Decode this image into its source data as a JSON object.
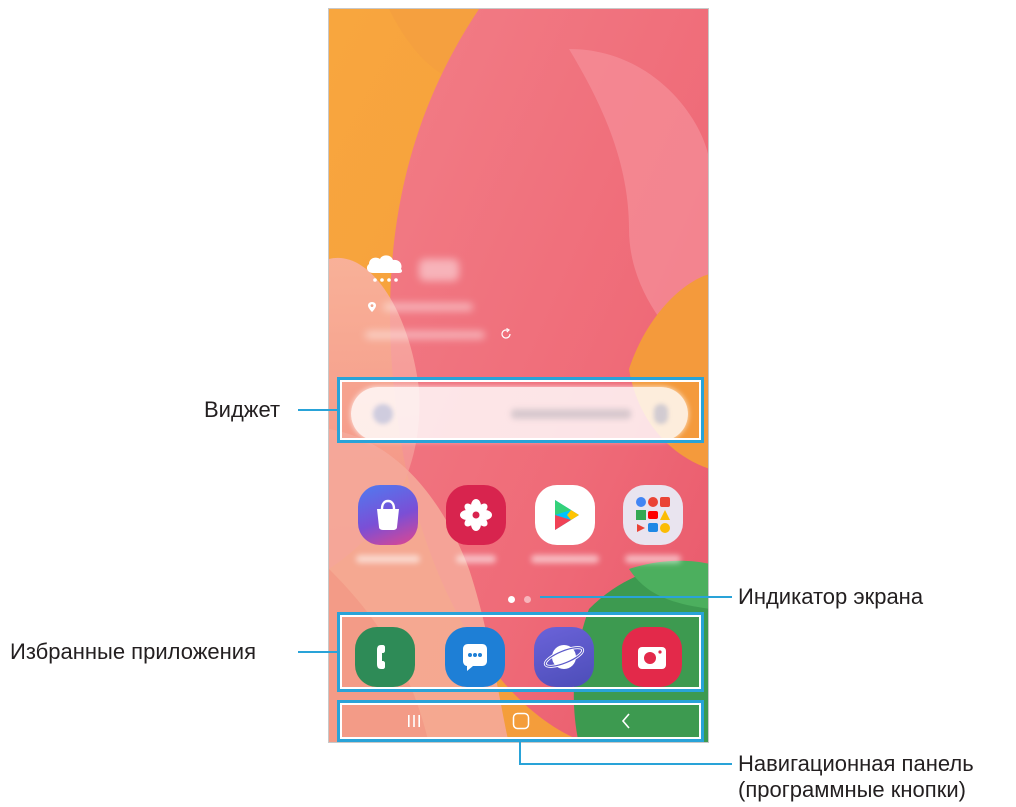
{
  "callouts": {
    "widget": "Виджет",
    "favorites": "Избранные приложения",
    "screen_indicator": "Индикатор экрана",
    "navigation_bar_line1": "Навигационная панель",
    "navigation_bar_line2": "(программные кнопки)"
  },
  "home_screen": {
    "apps": [
      {
        "icon": "galaxy-store-icon",
        "color": "#3d6ee8"
      },
      {
        "icon": "gallery-icon",
        "color": "#d8244e"
      },
      {
        "icon": "play-store-icon",
        "color": "#ffffff"
      },
      {
        "icon": "google-folder-icon",
        "color": "#e9e4ef"
      }
    ],
    "favorites": [
      {
        "icon": "phone-icon",
        "color": "#2e8b57"
      },
      {
        "icon": "messages-icon",
        "color": "#1e7fd6"
      },
      {
        "icon": "internet-icon",
        "color": "#5b59c9"
      },
      {
        "icon": "camera-icon",
        "color": "#e3294a"
      }
    ],
    "page_indicator": {
      "pages": 2,
      "current": 1
    },
    "navigation": [
      "recent-apps-icon",
      "home-icon",
      "back-icon"
    ]
  },
  "colors": {
    "highlight": "#29a3d8",
    "wallpaper_orange": "#f7a23a",
    "wallpaper_pink": "#f06877",
    "wallpaper_green": "#3d9a50"
  }
}
